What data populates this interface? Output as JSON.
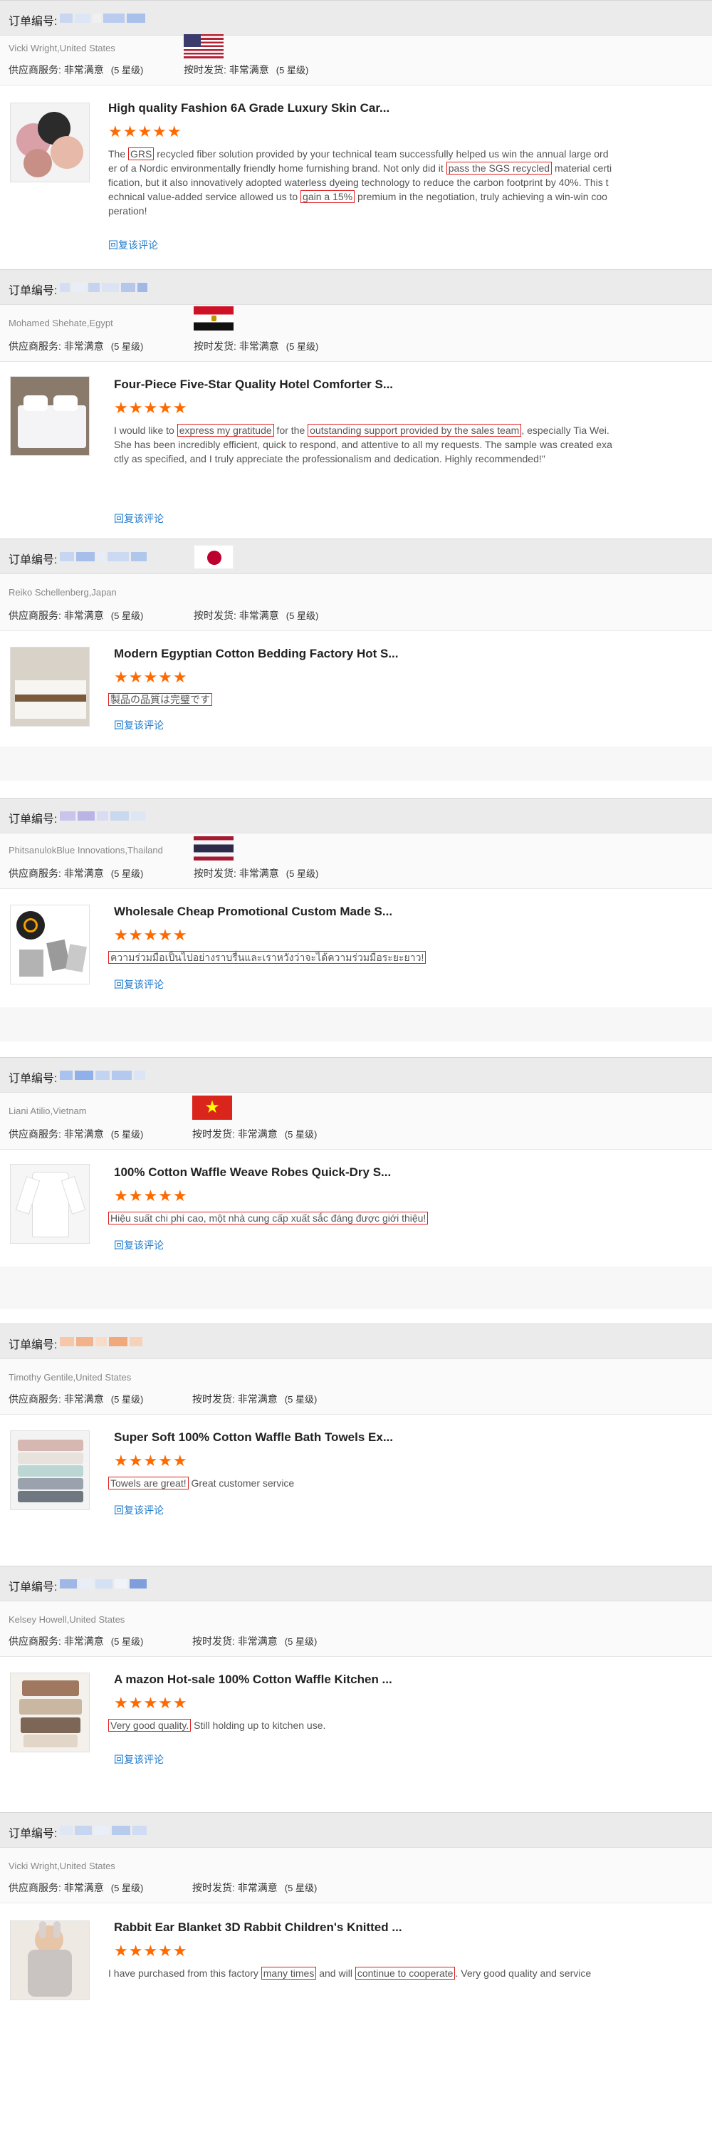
{
  "order_label": "订单编号:",
  "service_label": "供应商服务: 非常满意",
  "ship_label": "按时发货: 非常满意",
  "level_label": "(5 星级)",
  "reply_label": "回复该评论",
  "stars": "★★★★★",
  "reviews": [
    {
      "buyer": "Vicki Wright,United States",
      "flag": "us",
      "product_title": "High quality Fashion 6A Grade Luxury Skin Car...",
      "thumb": "scrunchies",
      "text_parts": [
        {
          "t": "The ",
          "h": false
        },
        {
          "t": "GRS",
          "h": true
        },
        {
          "t": " recycled fiber solution provided by your technical team successfully helped us win the annual large order of a Nordic environmentally friendly home furnishing brand. Not only did it ",
          "h": false
        },
        {
          "t": "pass the SGS recycled",
          "h": true
        },
        {
          "t": " material certification, but it also innovatively adopted waterless dyeing technology to reduce the carbon footprint by 40%. This technical value-added service allowed us to ",
          "h": false
        },
        {
          "t": "gain a 15%",
          "h": true
        },
        {
          "t": " premium in the negotiation, truly achieving a win-win cooperation!",
          "h": false
        }
      ]
    },
    {
      "buyer": "Mohamed Shehate,Egypt",
      "flag": "eg",
      "product_title": "Four-Piece Five-Star Quality Hotel Comforter S...",
      "thumb": "hotel-bed",
      "text_parts": [
        {
          "t": "I would like to ",
          "h": false
        },
        {
          "t": "express my gratitude",
          "h": true
        },
        {
          "t": " for the ",
          "h": false
        },
        {
          "t": "outstanding support provided by the sales team",
          "h": true
        },
        {
          "t": ", especially Tia Wei. She has been incredibly efficient, quick to respond, and attentive to all my requests. The sample was created exactly as specified, and I truly appreciate the professionalism and dedication. Highly recommended!\"",
          "h": false
        }
      ]
    },
    {
      "buyer": "Reiko Schellenberg,Japan",
      "flag": "jp",
      "product_title": "Modern Egyptian Cotton Bedding Factory Hot S...",
      "thumb": "bedding",
      "text_parts": [
        {
          "t": "製品の品質は完璧です",
          "h": true
        }
      ]
    },
    {
      "buyer": "PhitsanulokBlue Innovations,Thailand",
      "flag": "th",
      "product_title": "Wholesale Cheap Promotional Custom Made S...",
      "thumb": "towels-grey",
      "text_parts": [
        {
          "t": "ความร่วมมือเป็นไปอย่างราบรื่นและเราหวังว่าจะได้ความร่วมมือระยะยาว!",
          "h": true
        }
      ]
    },
    {
      "buyer": "Liani Atilio,Vietnam",
      "flag": "vn",
      "product_title": "100% Cotton Waffle Weave Robes Quick-Dry S...",
      "thumb": "robe",
      "text_parts": [
        {
          "t": "Hiệu suất chi phí cao, một nhà cung cấp xuất sắc đáng được giới thiệu!",
          "h": true
        }
      ]
    },
    {
      "buyer": "Timothy Gentile,United States",
      "flag": "none",
      "product_title": "Super Soft 100% Cotton Waffle Bath Towels Ex...",
      "thumb": "towel-stack",
      "text_parts": [
        {
          "t": "Towels are great!",
          "h": true
        },
        {
          "t": " Great customer service",
          "h": false
        }
      ]
    },
    {
      "buyer": "Kelsey Howell,United States",
      "flag": "none",
      "product_title": "A mazon Hot-sale 100% Cotton Waffle Kitchen ...",
      "thumb": "kitchen-towels",
      "text_parts": [
        {
          "t": "Very good quality.",
          "h": true
        },
        {
          "t": " Still holding up to kitchen use.",
          "h": false
        }
      ]
    },
    {
      "buyer": "Vicki Wright,United States",
      "flag": "none",
      "product_title": "Rabbit Ear Blanket 3D Rabbit Children's Knitted ...",
      "thumb": "rabbit-blanket",
      "text_parts": [
        {
          "t": "I have purchased from this factory ",
          "h": false
        },
        {
          "t": "many times",
          "h": true
        },
        {
          "t": " and will ",
          "h": false
        },
        {
          "t": "continue to cooperate",
          "h": true
        },
        {
          "t": ". Very good quality and service",
          "h": false
        }
      ]
    }
  ],
  "colors": {
    "accent_link": "#1f7acc",
    "star": "#ff6a00",
    "highlight_border": "#e02020",
    "order_bar": "#ebebeb"
  }
}
